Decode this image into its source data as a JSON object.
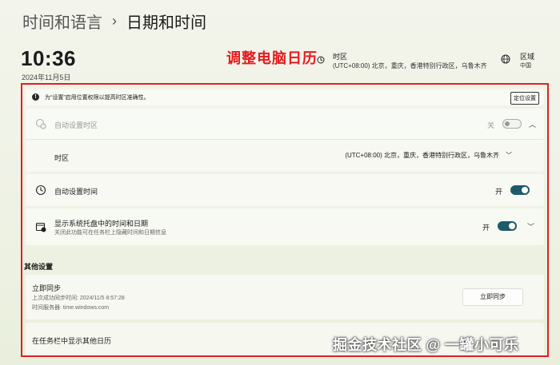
{
  "header": {
    "parent": "时间和语言",
    "separator": "›",
    "title": "日期和时间"
  },
  "clock": {
    "time": "10:36",
    "date": "2024年11月5日"
  },
  "annotation": "调整电脑日历",
  "timezone_summary": {
    "title": "时区",
    "value": "(UTC+08:00) 北京，重庆，香港特别行政区，乌鲁木齐"
  },
  "region_summary": {
    "title": "区域",
    "value": "中国"
  },
  "info_bar": {
    "text": "为“设置”启用位置权限以提高时区准确性。",
    "button": "定位设置"
  },
  "auto_timezone": {
    "label": "自动设置时区",
    "state_label": "关",
    "state": false
  },
  "timezone": {
    "label": "时区",
    "value": "(UTC+08:00) 北京，重庆，香港特别行政区，乌鲁木齐"
  },
  "auto_time": {
    "label": "自动设置时间",
    "state_label": "开",
    "state": true
  },
  "tray": {
    "label": "显示系统托盘中的时间和日期",
    "description": "关闭此功能可在任务栏上隐藏时间和日期信息",
    "state_label": "开",
    "state": true
  },
  "other_settings": {
    "heading": "其他设置"
  },
  "sync": {
    "title": "立即同步",
    "last_sync": "上次成功同步时间: 2024/11/5 8:57:28",
    "server": "时间服务器: time.windows.com",
    "button": "立即同步"
  },
  "calendar": {
    "label": "在任务栏中显示其他日历"
  },
  "watermark": "掘金技术社区 @ 一罐小可乐",
  "colors": {
    "accent": "#1e5a6a",
    "annotation": "#e8191c",
    "highlight_border": "#e02020"
  }
}
